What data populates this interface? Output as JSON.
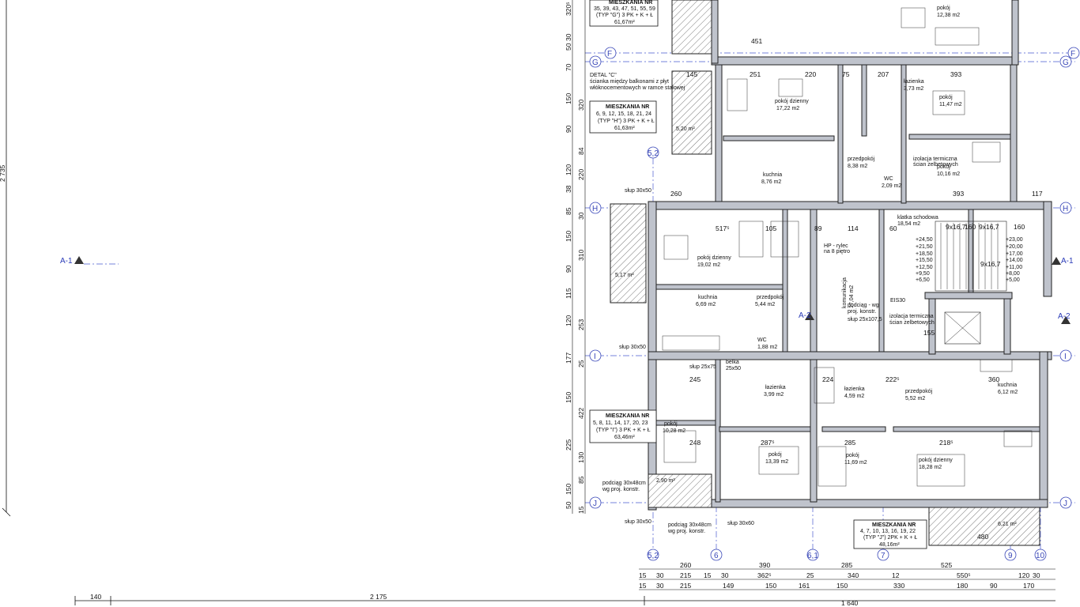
{
  "axes": {
    "rows": [
      {
        "label": "F"
      },
      {
        "label": "G"
      },
      {
        "label": "H"
      },
      {
        "label": "I"
      },
      {
        "label": "J"
      }
    ],
    "columns": [
      {
        "label": "5,2"
      },
      {
        "label": "6"
      },
      {
        "label": "6,1"
      },
      {
        "label": "7"
      },
      {
        "label": "9"
      },
      {
        "label": "10"
      }
    ]
  },
  "sections": {
    "a1_left": "A-1",
    "a1_right": "A-1",
    "a2_mid": "A-2",
    "a2_right": "A-2"
  },
  "apartment_labels": [
    {
      "title": "MIESZKANIA NR",
      "numbers": "35, 39, 43, 47, 51, 55, 59",
      "type": "(TYP \"G\")  3 PK + K + Ł",
      "area": "61,67m²"
    },
    {
      "title": "MIESZKANIA NR",
      "numbers": "6, 9, 12, 15, 18, 21, 24",
      "type": "(TYP \"H\") 3 PK + K + Ł",
      "area": "61,63m²"
    },
    {
      "title": "MIESZKANIA NR",
      "numbers": "5, 8, 11, 14, 17, 20, 23",
      "type": "(TYP \"I\")  3 PK + K + Ł",
      "area": "63,46m²"
    },
    {
      "title": "MIESZKANIA NR",
      "numbers": "4, 7, 10, 13, 16, 19, 22",
      "type": "(TYP \"J\")  2PK + K + Ł",
      "area": "48,16m²"
    }
  ],
  "rooms": [
    {
      "name": "pokój dzienny",
      "area": "17,22 m2"
    },
    {
      "name": "pokój",
      "area": "12,38 m2"
    },
    {
      "name": "łazienka",
      "area": "3,73 m2"
    },
    {
      "name": "pokój",
      "area": "11,47 m2"
    },
    {
      "name": "pokój",
      "area": "10,16 m2"
    },
    {
      "name": "przedpokój",
      "area": "8,38 m2"
    },
    {
      "name": "kuchnia",
      "area": "8,76 m2"
    },
    {
      "name": "WC",
      "area": "2,09 m2"
    },
    {
      "name": "klatka schodowa",
      "area": "18,54 m2"
    },
    {
      "name": "pokój dzienny",
      "area": "19,02 m2"
    },
    {
      "name": "kuchnia",
      "area": "6,69 m2"
    },
    {
      "name": "przedpokój",
      "area": "5,44 m2"
    },
    {
      "name": "WC",
      "area": "1,88 m2"
    },
    {
      "name": "komunikacja",
      "area": "17,04 m2"
    },
    {
      "name": "łazienka",
      "area": "3,99 m2"
    },
    {
      "name": "łazienka",
      "area": "4,59 m2"
    },
    {
      "name": "przedpokój",
      "area": "5,52 m2"
    },
    {
      "name": "kuchnia",
      "area": "6,12 m2"
    },
    {
      "name": "pokój",
      "area": "10,28 m2"
    },
    {
      "name": "pokój",
      "area": "13,39 m2"
    },
    {
      "name": "pokój",
      "area": "11,69 m2"
    },
    {
      "name": "pokój dzienny",
      "area": "18,28 m2"
    }
  ],
  "balconies": [
    {
      "area": "5,20 m²"
    },
    {
      "area": "5,17 m²"
    },
    {
      "area": "2,90 m²"
    },
    {
      "area": "6,21 m²"
    }
  ],
  "notes": {
    "detal_title": "DETAL \"C\"",
    "detal_1": "ścianka między balkonami z płyt",
    "detal_2": "włóknocementowych w ramce stalowej",
    "slup_1": "słup 30x50",
    "slup_2": "słup 30x50",
    "slup_3": "słup 30x50",
    "slup_4": "słup 30x60",
    "slup_5": "słup 25x75",
    "slup_6": "słup 25x107,5",
    "podciag_1": "podciąg 30x48cm",
    "podciag_1b": "wg proj. konstr.",
    "podciag_2": "podciąg 30x48cm",
    "podciag_2b": "wg proj. konstr.",
    "podciag_3": "podciąg - wg",
    "podciag_3b": "proj. konstr.",
    "hp_note": "HP - rylec",
    "hp_note_b": "na 8 piętro",
    "belka": "belka",
    "belka_b": "25x50",
    "izolacja_1": "izolacja termiczna",
    "izolacja_1b": "ścian żelbetowych",
    "izolacja_2": "izolacja termiczna",
    "izolacja_2b": "ścian żelbetowych",
    "eis": "EIS30",
    "levels_left": [
      "+24,50",
      "+21,50",
      "+18,50",
      "+15,50",
      "+12,50",
      "+9,50",
      "+6,50"
    ],
    "levels_right": [
      "+23,00",
      "+20,00",
      "+17,00",
      "+14,00",
      "+11,00",
      "+8,00",
      "+5,00"
    ],
    "stairs_1": "9x16,7",
    "stairs_2": "9x16,7",
    "stairs_3": "9x16,7"
  },
  "dimensions": {
    "bottom_row1": [
      "260",
      "390",
      "285",
      "525"
    ],
    "bottom_row2": [
      "15",
      "30",
      "215",
      "15",
      "30",
      "362⁵",
      "25",
      "340",
      "12",
      "550⁵",
      "120",
      "30"
    ],
    "bottom_row3": [
      "15",
      "30",
      "215",
      "149",
      "150",
      "161",
      "150",
      "330",
      "180",
      "90",
      "170"
    ],
    "bottom_total_left": "140",
    "bottom_total_mid": "2 175",
    "bottom_total_right": "1 640",
    "left_total": "2 735",
    "left_column": [
      "320⁵",
      "30",
      "50",
      "70",
      "150",
      "320",
      "150",
      "90",
      "84",
      "120",
      "220",
      "38",
      "85",
      "30",
      "150",
      "310",
      "90",
      "115",
      "120",
      "253",
      "177",
      "25",
      "150",
      "422",
      "225",
      "130",
      "85",
      "150",
      "50",
      "15"
    ],
    "interior": [
      "451",
      "251",
      "220",
      "75",
      "207",
      "393",
      "145",
      "260",
      "517⁵",
      "105",
      "89",
      "114",
      "60",
      "160",
      "160",
      "393",
      "155",
      "117",
      "245",
      "224",
      "222⁵",
      "360",
      "287⁵",
      "285",
      "218⁵",
      "248",
      "480"
    ]
  }
}
